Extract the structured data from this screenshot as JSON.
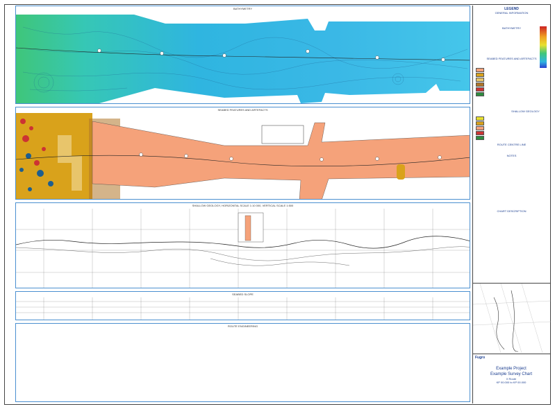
{
  "panels": {
    "bathymetry_title": "BATHYMETRY",
    "seabed_title": "SEABED FEATURES AND ARTEFACTS",
    "geology_title": "SHALLOW GEOLOGY, HORIZONTAL SCALE 1:10 000, VERTICAL SCALE 1:500",
    "slope_title": "SEABED SLOPE",
    "route_title": "ROUTE ENGINEERING"
  },
  "legend": {
    "title": "LEGEND",
    "general_info": "GENERAL INFORMATION",
    "bathymetry_h": "BATHYMETRY",
    "seabed_h": "SEABED FEATURES AND ARTEFACTS",
    "shallow_h": "SHALLOW GEOLOGY",
    "centre_h": "ROUTE CENTRE LINE",
    "notes_h": "NOTES",
    "chart_desc_h": "CHART DESCRIPTION",
    "colors": {
      "sand": "#f5a27a",
      "gravel": "#d9a21b",
      "clay": "#e8c56b",
      "rock": "#b0762a",
      "red": "#cc3333",
      "green": "#2e8b3f"
    }
  },
  "title_block": {
    "company": "Fugro",
    "project": "Example Project",
    "chart_title": "Example Survey Chart",
    "route": "X Route",
    "kp_range": "KP 00.000 to KP 00.000"
  }
}
